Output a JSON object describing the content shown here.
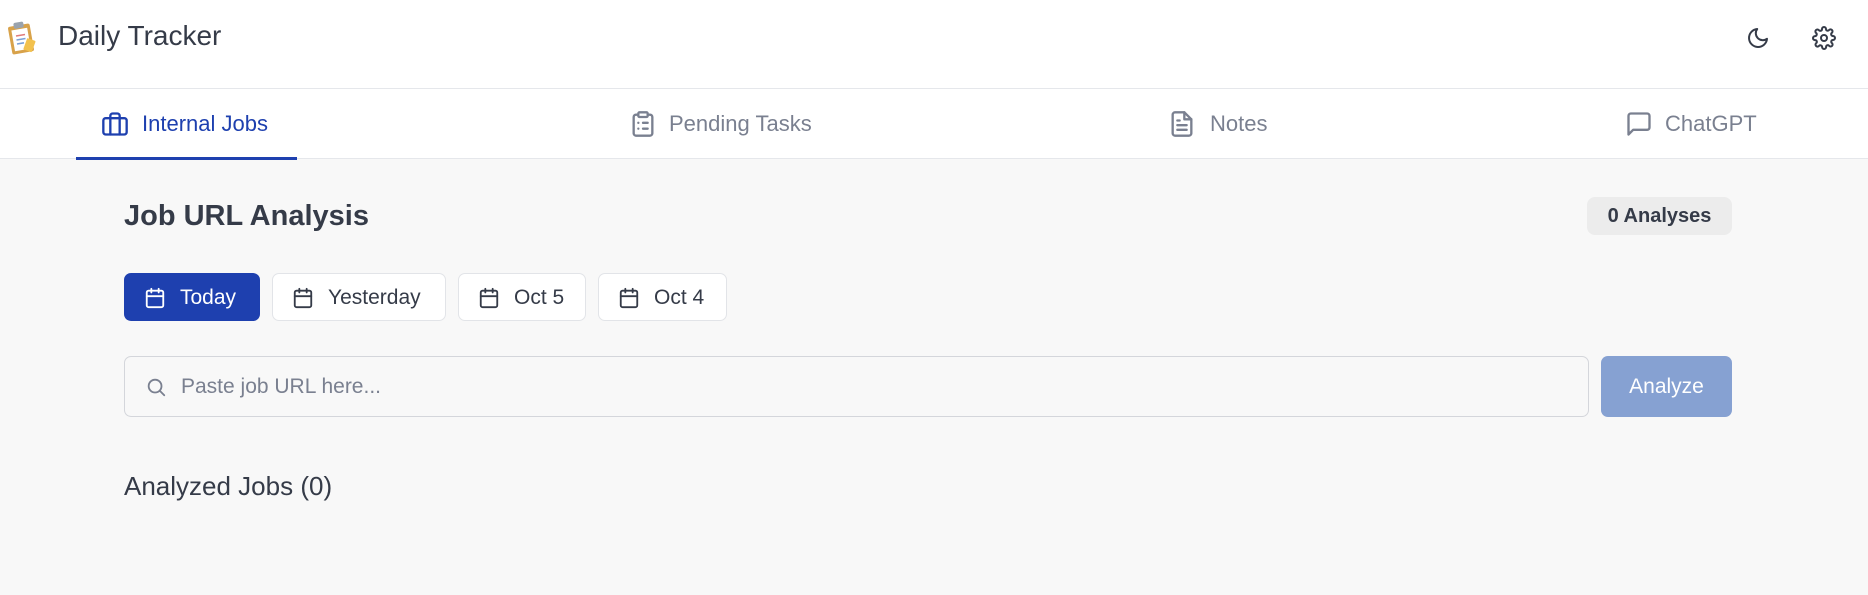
{
  "header": {
    "title": "Daily Tracker",
    "logo_icon": "clipboard-emoji-icon",
    "theme_icon": "moon-icon",
    "settings_icon": "gear-icon"
  },
  "tabs": [
    {
      "label": "Internal Jobs",
      "icon": "briefcase-icon",
      "active": true
    },
    {
      "label": "Pending Tasks",
      "icon": "clipboard-list-icon",
      "active": false
    },
    {
      "label": "Notes",
      "icon": "file-text-icon",
      "active": false
    },
    {
      "label": "ChatGPT",
      "icon": "message-square-icon",
      "active": false
    }
  ],
  "main": {
    "title": "Job URL Analysis",
    "analyses_badge": "0 Analyses",
    "date_filters": [
      {
        "label": "Today",
        "active": true
      },
      {
        "label": "Yesterday",
        "active": false
      },
      {
        "label": "Oct 5",
        "active": false
      },
      {
        "label": "Oct 4",
        "active": false
      }
    ],
    "search": {
      "placeholder": "Paste job URL here...",
      "value": ""
    },
    "analyze_label": "Analyze",
    "analyzed_title": "Analyzed Jobs (0)"
  },
  "colors": {
    "accent": "#1e40af",
    "analyze_disabled": "#86a1d2",
    "background": "#f8f8f8",
    "text": "#353b48",
    "muted_text": "#7a8090"
  }
}
